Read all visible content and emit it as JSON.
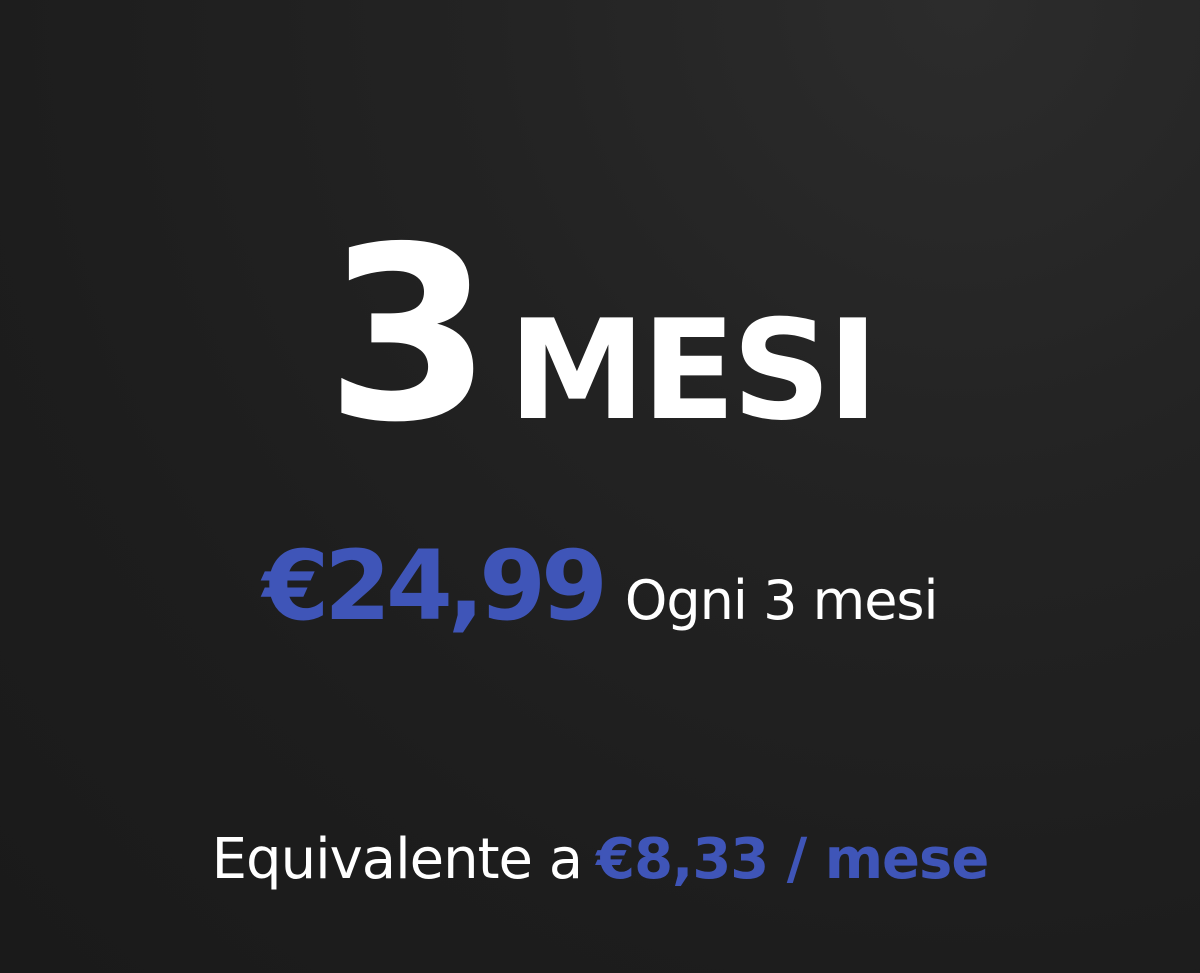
{
  "plan": {
    "number": "3",
    "unit": "MESI"
  },
  "price": {
    "amount": "€24,99",
    "period": "Ogni 3 mesi"
  },
  "equivalent": {
    "prefix": "Equivalente a",
    "price": "€8,33 / mese"
  },
  "colors": {
    "accent": "#3f55b8",
    "text": "#ffffff",
    "background": "#1e1e1e"
  }
}
